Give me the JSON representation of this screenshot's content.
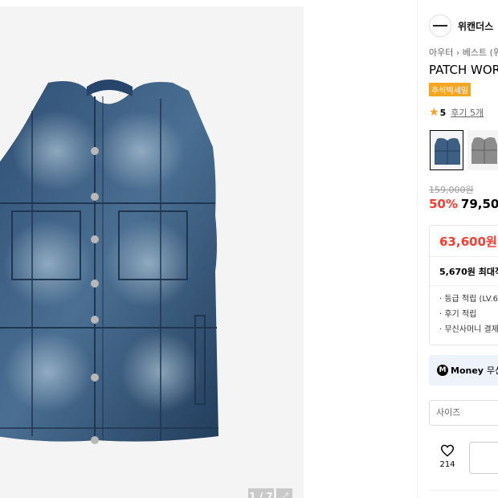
{
  "gallery": {
    "counter": "1 / 7",
    "expand_icon": "expand-icon"
  },
  "brand": {
    "name": "위캔더스",
    "logo_icon": "brand-logo-icon"
  },
  "breadcrumb": {
    "items": [
      "아우터",
      "베스트 (위"
    ]
  },
  "product": {
    "title": "PATCH WOR",
    "badge": "추석빅세일",
    "rating": "5",
    "reviews": "후기 5개",
    "original_price": "159,000원",
    "discount": "50%",
    "price": "79,500"
  },
  "coupon": {
    "price": "63,600원",
    "point_max": "5,670원 최대적",
    "points": [
      "· 등급 적립 (LV.6",
      "· 후기 적립",
      "· 무신사머니 결제"
    ]
  },
  "money": {
    "icon": "M",
    "label": "Money",
    "rest": "무신"
  },
  "options": {
    "size_placeholder": "사이즈"
  },
  "like": {
    "count": "214"
  },
  "colors": {
    "accent_red": "#ff3b30",
    "badge_orange": "#f5a623",
    "money_bg": "#eef2fb"
  }
}
